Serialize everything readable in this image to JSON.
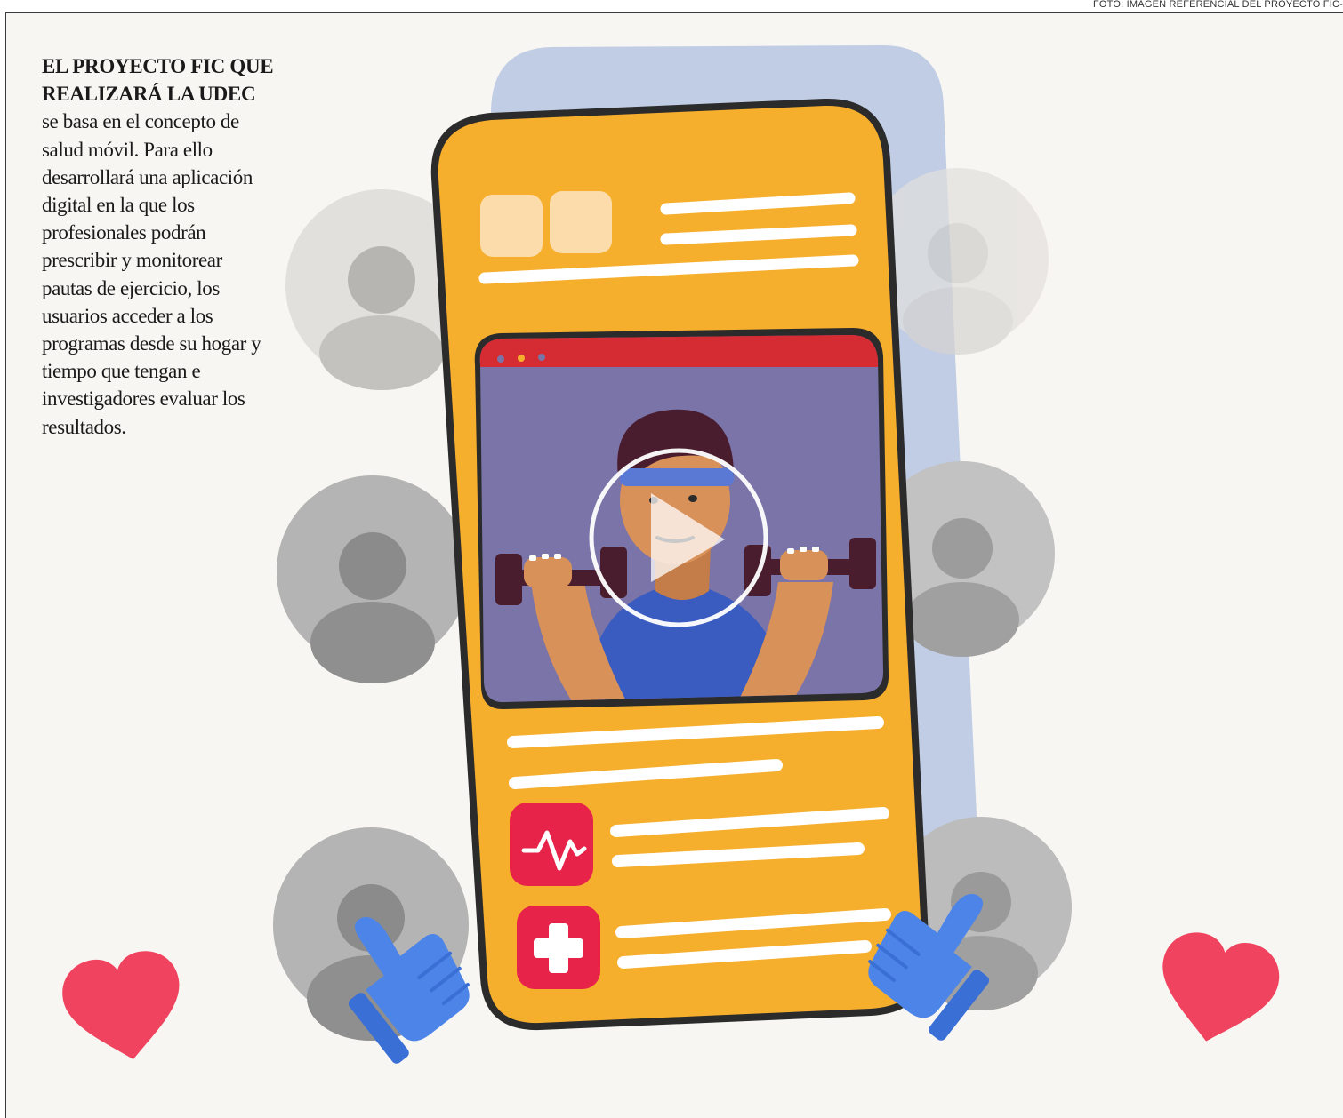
{
  "photo_credit": "FOTO: IMAGEN REFERENCIAL DEL PROYECTO FIC-",
  "caption": {
    "title": "EL PROYECTO FIC QUE REALIZARÁ LA UDEC",
    "body": "se basa en el concepto de salud móvil. Para ello desarrollará una aplicación digital en la que los profesionales podrán prescribir y monitorear pautas de ejercicio, los usuarios acceder a los programas desde su hogar y tiempo que tengan e investigadores evaluar los resultados."
  },
  "icons": [
    "heart-icon",
    "thumbs-up-icon",
    "play-icon",
    "heartbeat-icon",
    "medical-cross-icon",
    "user-avatar-icon"
  ],
  "colors": {
    "phone_body": "#f6ae2d",
    "phone_outline": "#2b2b2b",
    "backdrop_card": "#b9c9e2",
    "video_bg": "#7a74a8",
    "video_titlebar": "#d52b32",
    "app_icon_red": "#e8234a",
    "heart": "#f0435f",
    "thumb": "#4d84e8",
    "avatar_grey": "#b4b4b4",
    "shirt": "#3a5cc0",
    "skin": "#d9915a",
    "hair": "#4a1d2e"
  }
}
